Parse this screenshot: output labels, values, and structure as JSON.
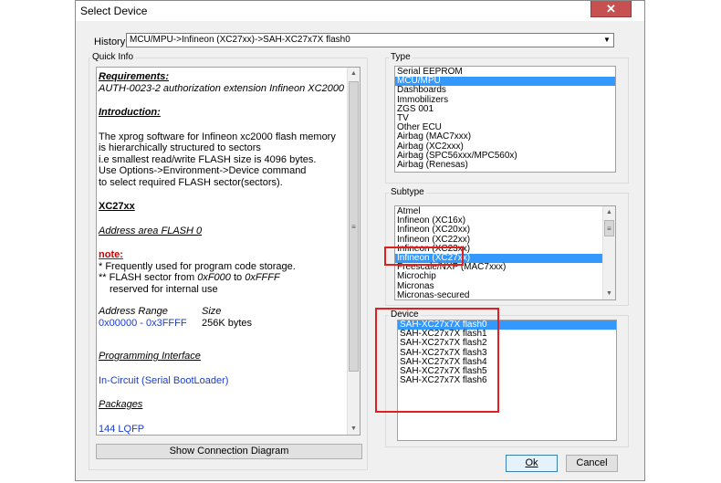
{
  "window": {
    "title": "Select Device",
    "close_label": "✕"
  },
  "history": {
    "label": "History:",
    "value": "MCU/MPU->Infineon (XC27xx)->SAH-XC27x7X flash0"
  },
  "quick_info": {
    "label": "Quick Info",
    "requirements_heading": "Requirements:",
    "requirements_text": "AUTH-0023-2 authorization extension Infineon XC2000",
    "introduction_heading": "Introduction:",
    "intro_lines": [
      "The xprog software for Infineon xc2000 flash memory",
      "is hierarchically structured to sectors",
      "i.e smallest read/write FLASH size is 4096 bytes.",
      "Use Options->Environment->Device command",
      "to select required FLASH  sector(sectors)."
    ],
    "device_heading": "XC27xx",
    "address_area": "Address area FLASH 0",
    "note_heading": "note:",
    "note_line1": "* Frequently used for program code storage.",
    "note_line2_prefix": "** FLASH sector from ",
    "note_start": "0xF000",
    "note_to": " to ",
    "note_end": "0xFFFF",
    "note_line3": "reserved for internal use",
    "address_range_label": "Address Range",
    "size_label": "Size",
    "address_range_value": "0x00000 - 0x3FFFF",
    "size_value": "256K bytes",
    "programming_interface_heading": "Programming Interface",
    "programming_interface_value": "In-Circuit (Serial BootLoader)",
    "packages_heading": "Packages",
    "packages_value": "144 LQFP"
  },
  "show_connection_button": "Show Connection Diagram",
  "type": {
    "label": "Type",
    "items": [
      "Serial EEPROM",
      "MCU/MPU",
      "Dashboards",
      "Immobilizers",
      "ZGS 001",
      "TV",
      "Other ECU",
      "Airbag (MAC7xxx)",
      "Airbag (XC2xxx)",
      "Airbag (SPC56xxx/MPC560x)",
      "Airbag (Renesas)"
    ],
    "selected_index": 1
  },
  "subtype": {
    "label": "Subtype",
    "items": [
      "Atmel",
      "Infineon (XC16x)",
      "Infineon (XC20xx)",
      "Infineon (XC22xx)",
      "Infineon (XC23xx)",
      "Infineon (XC27xx)",
      "Freescale/NXP (MAC7xxx)",
      "Microchip",
      "Micronas",
      "Micronas-secured"
    ],
    "selected_index": 5
  },
  "device": {
    "label": "Device",
    "items": [
      "SAH-XC27x7X flash0",
      "SAH-XC27x7X flash1",
      "SAH-XC27x7X flash2",
      "SAH-XC27x7X flash3",
      "SAH-XC27x7X flash4",
      "SAH-XC27x7X flash5",
      "SAH-XC27x7X flash6"
    ],
    "selected_index": 0
  },
  "buttons": {
    "ok": "Ok",
    "cancel": "Cancel"
  },
  "colors": {
    "selection": "#3399ff",
    "highlight_box": "#e02020",
    "link_blue": "#1a3cc8",
    "note_red": "#cc0000"
  }
}
